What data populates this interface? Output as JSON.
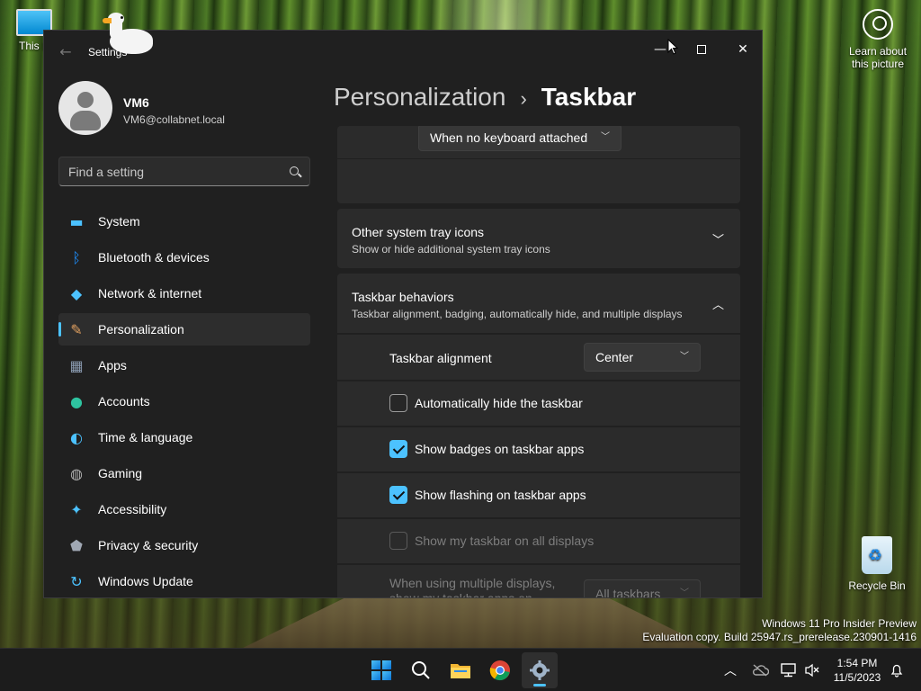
{
  "desktop": {
    "this_pc_label": "This P",
    "learn_label": "Learn about this picture",
    "recycle_label": "Recycle Bin",
    "watermark_line1": "Windows 11 Pro Insider Preview",
    "watermark_line2": "Evaluation copy. Build 25947.rs_prerelease.230901-1416"
  },
  "window": {
    "title": "Settings",
    "back_glyph": "←",
    "minimize_glyph": "—",
    "close_glyph": "✕"
  },
  "user": {
    "name": "VM6",
    "email": "VM6@collabnet.local"
  },
  "search": {
    "placeholder": "Find a setting"
  },
  "nav": {
    "items": [
      {
        "label": "System",
        "icon": "monitor-icon",
        "color": "#4cc2ff"
      },
      {
        "label": "Bluetooth & devices",
        "icon": "bluetooth-icon",
        "color": "#1e90ff"
      },
      {
        "label": "Network & internet",
        "icon": "wifi-icon",
        "color": "#4cc2ff"
      },
      {
        "label": "Personalization",
        "icon": "brush-icon",
        "color": "#e0a060"
      },
      {
        "label": "Apps",
        "icon": "apps-icon",
        "color": "#8a9bb0"
      },
      {
        "label": "Accounts",
        "icon": "person-icon",
        "color": "#2ec4a0"
      },
      {
        "label": "Time & language",
        "icon": "globe-clock-icon",
        "color": "#4cc2ff"
      },
      {
        "label": "Gaming",
        "icon": "gamepad-icon",
        "color": "#b0b0b0"
      },
      {
        "label": "Accessibility",
        "icon": "accessibility-icon",
        "color": "#4cc2ff"
      },
      {
        "label": "Privacy & security",
        "icon": "shield-icon",
        "color": "#a0a8b4"
      },
      {
        "label": "Windows Update",
        "icon": "update-icon",
        "color": "#4cc2ff"
      }
    ],
    "selected": "Personalization"
  },
  "breadcrumb": {
    "parent": "Personalization",
    "separator": "›",
    "current": "Taskbar"
  },
  "content": {
    "keyboard_dropdown": "When no keyboard attached",
    "other_tray": {
      "title": "Other system tray icons",
      "subtitle": "Show or hide additional system tray icons",
      "expanded": false
    },
    "behaviors": {
      "title": "Taskbar behaviors",
      "subtitle": "Taskbar alignment, badging, automatically hide, and multiple displays",
      "expanded": true,
      "alignment_label": "Taskbar alignment",
      "alignment_value": "Center",
      "auto_hide_label": "Automatically hide the taskbar",
      "auto_hide_checked": false,
      "badges_label": "Show badges on taskbar apps",
      "badges_checked": true,
      "flashing_label": "Show flashing on taskbar apps",
      "flashing_checked": true,
      "all_displays_label": "Show my taskbar on all displays",
      "all_displays_checked": false,
      "multi_display_label": "When using multiple displays, show my taskbar apps on",
      "multi_display_value": "All taskbars"
    }
  },
  "taskbar": {
    "clock_time": "1:54 PM",
    "clock_date": "11/5/2023",
    "accent": "#4cc2ff"
  }
}
